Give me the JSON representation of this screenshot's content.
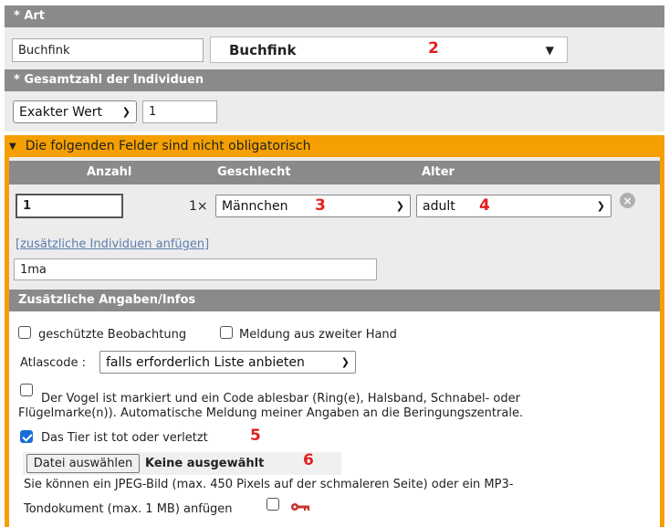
{
  "art": {
    "header": "* Art",
    "input_value": "Buchfink",
    "select_value": "Buchfink",
    "marker": "2"
  },
  "gesamt": {
    "header": "* Gesamtzahl der Individuen",
    "select_value": "Exakter Wert",
    "input_value": "1"
  },
  "optional": {
    "header": "Die folgenden Felder sind nicht obligatorisch",
    "col_anzahl": "Anzahl",
    "col_geschlecht": "Geschlecht",
    "col_alter": "Alter",
    "anzahl_value": "1",
    "multiplier": "1×",
    "geschlecht_value": "Männchen",
    "geschlecht_marker": "3",
    "alter_value": "adult",
    "alter_marker": "4",
    "add_link": "[zusätzliche Individuen anfügen]",
    "summary_value": "1ma"
  },
  "extra": {
    "header": "Zusätzliche Angaben/Infos",
    "protected_label": "geschützte Beobachtung",
    "secondhand_label": "Meldung aus zweiter Hand",
    "atlascode_label": "Atlascode :",
    "atlascode_value": "falls erforderlich Liste anbieten",
    "marked_line1": "Der Vogel ist markiert und ein Code ablesbar (Ring(e), Halsband, Schnabel- oder",
    "marked_line2": "Flügelmarke(n)). Automatische Meldung meiner Angaben an die Beringungszentrale.",
    "dead_label": "Das Tier ist tot oder verletzt",
    "dead_marker": "5",
    "dead_checked": true,
    "file_button": "Datei auswählen",
    "file_status": "Keine ausgewählt",
    "file_marker": "6",
    "file_help_line1": "Sie können ein JPEG-Bild (max. 450 Pixels auf der schmaleren Seite) oder ein MP3-",
    "file_help_line2": "Tondokument (max. 1 MB) anfügen"
  },
  "colors": {
    "header_gray": "#8a8a8a",
    "panel_gray": "#ececec",
    "orange": "#f5a000",
    "marker_red": "#e02020",
    "link_blue": "#5a7fb0"
  }
}
